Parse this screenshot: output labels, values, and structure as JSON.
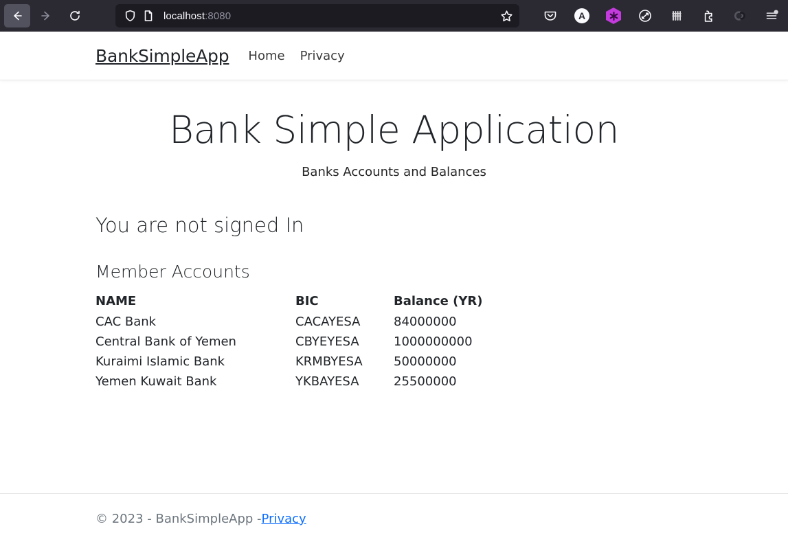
{
  "browser": {
    "back_label": "Back",
    "forward_label": "Forward",
    "reload_label": "Reload",
    "shield_label": "Tracking protection",
    "page_info_label": "Page info",
    "url_host": "localhost",
    "url_port": ":8080",
    "bookmark_label": "Bookmark this page",
    "extensions": [
      {
        "name": "pocket-icon",
        "label": "Save to Pocket"
      },
      {
        "name": "circle-a-icon",
        "label": "A"
      },
      {
        "name": "purple-hexagon-icon",
        "label": "Extension"
      },
      {
        "name": "circle-slash-icon",
        "label": "Extension"
      },
      {
        "name": "fence-icon",
        "label": "Extension"
      },
      {
        "name": "puzzle-icon",
        "label": "Extensions"
      },
      {
        "name": "loop-icon",
        "label": "Extension"
      },
      {
        "name": "app-menu-icon",
        "label": "Open application menu"
      }
    ]
  },
  "site": {
    "brand": "BankSimpleApp",
    "nav": [
      {
        "label": "Home"
      },
      {
        "label": "Privacy"
      }
    ]
  },
  "main": {
    "title": "Bank Simple Application",
    "subtitle": "Banks Accounts and Balances",
    "signed_status": "You are not signed In",
    "section_title": "Member Accounts",
    "table": {
      "headers": [
        "NAME",
        "BIC",
        "Balance (YR)"
      ],
      "rows": [
        {
          "name": "CAC Bank",
          "bic": "CACAYESA",
          "balance": "84000000"
        },
        {
          "name": "Central Bank of Yemen",
          "bic": "CBYEYESA",
          "balance": "1000000000"
        },
        {
          "name": "Kuraimi Islamic Bank",
          "bic": "KRMBYESA",
          "balance": "50000000"
        },
        {
          "name": "Yemen Kuwait Bank",
          "bic": "YKBAYESA",
          "balance": "25500000"
        }
      ]
    }
  },
  "footer": {
    "text": "© 2023 - BankSimpleApp - ",
    "link": "Privacy"
  },
  "colors": {
    "chrome_bg": "#2b2a33",
    "urlbar_bg": "#1c1b22",
    "link_blue": "#0d6efd",
    "muted": "#6c757d",
    "hex_purple": "#c33bdc"
  }
}
